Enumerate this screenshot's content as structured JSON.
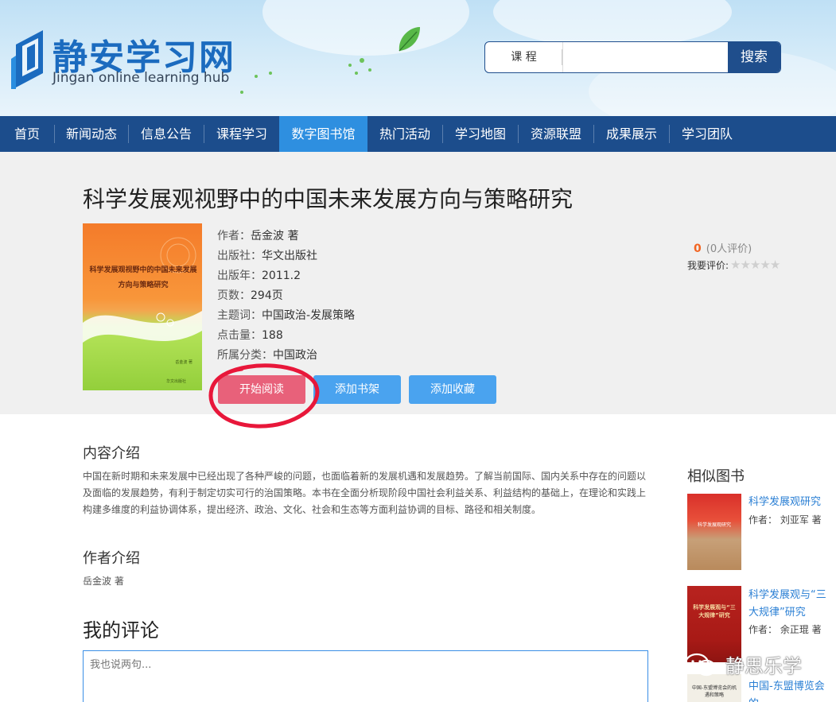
{
  "header": {
    "logo_cn": "静安学习网",
    "logo_en": "Jingan online learning hub",
    "search": {
      "category": "课 程",
      "value": "",
      "button": "搜索"
    }
  },
  "nav": {
    "items": [
      "首页",
      "新闻动态",
      "信息公告",
      "课程学习",
      "数字图书馆",
      "热门活动",
      "学习地图",
      "资源联盟",
      "成果展示",
      "学习团队"
    ],
    "active_index": 4
  },
  "book": {
    "title": "科学发展观视野中的中国未来发展方向与策略研究",
    "cover_line1": "科学发展观视野中的中国未来发展",
    "cover_line2": "方向与策略研究",
    "cover_author": "岳金波 著",
    "cover_publisher": "华文出版社",
    "meta": [
      {
        "label": "作者：",
        "value": "岳金波 著"
      },
      {
        "label": "出版社：",
        "value": "华文出版社"
      },
      {
        "label": "出版年：",
        "value": "2011.2"
      },
      {
        "label": "页数：",
        "value": "294页"
      },
      {
        "label": "主题词：",
        "value": "中国政治-发展策略"
      },
      {
        "label": "点击量：",
        "value": "188"
      },
      {
        "label": "所属分类：",
        "value": "中国政治"
      }
    ],
    "buttons": {
      "read": "开始阅读",
      "shelf": "添加书架",
      "fav": "添加收藏"
    },
    "rating": {
      "score": "0",
      "count": "(0人评价)",
      "rate_label": "我要评价:",
      "stars": "★★★★★"
    }
  },
  "content": {
    "intro_title": "内容介绍",
    "intro_text": "中国在新时期和未来发展中已经出现了各种严峻的问题，也面临着新的发展机遇和发展趋势。了解当前国际、国内关系中存在的问题以及面临的发展趋势，有利于制定切实可行的治国策略。本书在全面分析现阶段中国社会利益关系、利益结构的基础上，在理论和实践上构建多维度的利益协调体系，提出经济、政治、文化、社会和生态等方面利益协调的目标、路径和相关制度。",
    "author_title": "作者介绍",
    "author_text": "岳金波 著",
    "comment_title": "我的评论",
    "comment_placeholder": "我也说两句..."
  },
  "similar": {
    "title": "相似图书",
    "books": [
      {
        "name": "科学发展观研究",
        "author": "作者：  刘亚军 著",
        "cover_text": "科学发展观研究"
      },
      {
        "name": "科学发展观与“三大规律”研究",
        "author": "作者：  余正琨 著",
        "cover_text": "科学发展观与“三大规律”研究"
      },
      {
        "name": "中国-东盟博览会的…",
        "author": "",
        "cover_text": "中国-东盟博览会的机遇和策略"
      }
    ]
  },
  "watermark": "静思乐学",
  "colors": {
    "nav_bg": "#1c4d8c",
    "nav_active": "#2e8fe0",
    "read_btn": "#e8617a",
    "blue_btn": "#4aa3ef",
    "link": "#2a7fd4"
  }
}
